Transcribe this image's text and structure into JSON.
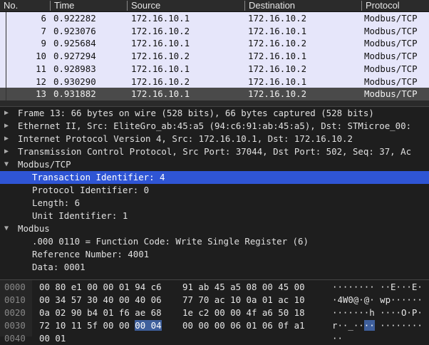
{
  "packet_list": {
    "columns": [
      "No.",
      "Time",
      "Source",
      "Destination",
      "Protocol"
    ],
    "rows": [
      {
        "no": "6",
        "time": "0.922282",
        "src": "172.16.10.1",
        "dst": "172.16.10.2",
        "proto": "Modbus/TCP"
      },
      {
        "no": "7",
        "time": "0.923076",
        "src": "172.16.10.2",
        "dst": "172.16.10.1",
        "proto": "Modbus/TCP"
      },
      {
        "no": "9",
        "time": "0.925684",
        "src": "172.16.10.1",
        "dst": "172.16.10.2",
        "proto": "Modbus/TCP"
      },
      {
        "no": "10",
        "time": "0.927294",
        "src": "172.16.10.2",
        "dst": "172.16.10.1",
        "proto": "Modbus/TCP"
      },
      {
        "no": "11",
        "time": "0.928983",
        "src": "172.16.10.1",
        "dst": "172.16.10.2",
        "proto": "Modbus/TCP"
      },
      {
        "no": "12",
        "time": "0.930290",
        "src": "172.16.10.2",
        "dst": "172.16.10.1",
        "proto": "Modbus/TCP"
      },
      {
        "no": "13",
        "time": "0.931882",
        "src": "172.16.10.1",
        "dst": "172.16.10.2",
        "proto": "Modbus/TCP",
        "selected": true
      }
    ]
  },
  "details": [
    {
      "text": "Frame 13: 66 bytes on wire (528 bits), 66 bytes captured (528 bits)",
      "level": 0,
      "arrow": "collapsed"
    },
    {
      "text": "Ethernet II, Src: EliteGro_ab:45:a5 (94:c6:91:ab:45:a5), Dst: STMicroe_00:",
      "level": 0,
      "arrow": "collapsed"
    },
    {
      "text": "Internet Protocol Version 4, Src: 172.16.10.1, Dst: 172.16.10.2",
      "level": 0,
      "arrow": "collapsed"
    },
    {
      "text": "Transmission Control Protocol, Src Port: 37044, Dst Port: 502, Seq: 37, Ac",
      "level": 0,
      "arrow": "collapsed"
    },
    {
      "text": "Modbus/TCP",
      "level": 0,
      "arrow": "expanded"
    },
    {
      "text": "Transaction Identifier: 4",
      "level": 1,
      "selected": true
    },
    {
      "text": "Protocol Identifier: 0",
      "level": 1
    },
    {
      "text": "Length: 6",
      "level": 1
    },
    {
      "text": "Unit Identifier: 1",
      "level": 1
    },
    {
      "text": "Modbus",
      "level": 0,
      "arrow": "expanded"
    },
    {
      "text": ".000 0110 = Function Code: Write Single Register (6)",
      "level": 1
    },
    {
      "text": "Reference Number: 4001",
      "level": 1
    },
    {
      "text": "Data: 0001",
      "level": 1
    }
  ],
  "hex": [
    {
      "off": "0000",
      "a": "00 80 e1 00 00 01 94 c6",
      "b": "91 ab 45 a5 08 00 45 00",
      "ascii": "········ ··E···E·"
    },
    {
      "off": "0010",
      "a": "00 34 57 30 40 00 40 06",
      "b": "77 70 ac 10 0a 01 ac 10",
      "ascii": "·4W0@·@· wp······"
    },
    {
      "off": "0020",
      "a": "0a 02 90 b4 01 f6 ae 68",
      "b": "1e c2 00 00 4f a6 50 18",
      "ascii": "·······h ····O·P·"
    },
    {
      "off": "0030",
      "a_pre": "72 10 11 5f 00 00 ",
      "a_hl": "00 04",
      "b": "00 00 00 06 01 06 0f a1",
      "ascii_pre": "r··_··",
      "ascii_hl": "··",
      "ascii_post": " ········"
    },
    {
      "off": "0040",
      "a": "00 01",
      "b": "",
      "ascii": "··"
    }
  ],
  "colors": {
    "list_bg": "#e6e6fa",
    "selected_row": "#4a4a4a",
    "detail_highlight": "#2f55d4",
    "hex_highlight": "#3e5f9c"
  }
}
